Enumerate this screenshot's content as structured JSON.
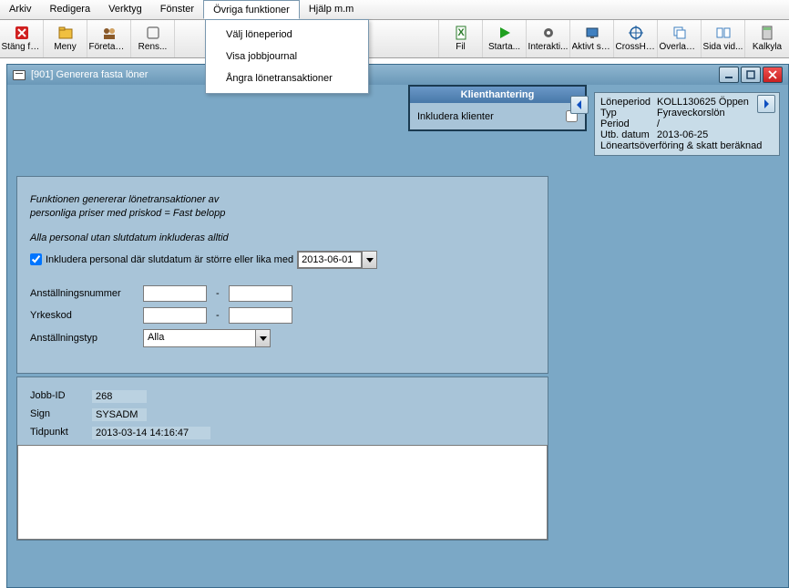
{
  "menubar": {
    "arkiv": "Arkiv",
    "redigera": "Redigera",
    "verktyg": "Verktyg",
    "fonster": "Fönster",
    "ovriga": "Övriga funktioner",
    "hjalp": "Hjälp m.m"
  },
  "dropdown": {
    "valj": "Välj löneperiod",
    "visa": "Visa jobbjournal",
    "angra": "Ångra lönetransaktioner"
  },
  "toolbar": {
    "stang": "Stäng fö...",
    "meny": "Meny",
    "foretag": "Företag/...",
    "rens": "Rens...",
    "fil": "Fil",
    "starta": "Starta...",
    "interakt": "Interakti...",
    "aktivt": "Aktivt skr...",
    "crosshair": "CrossHair",
    "overlapp": "Överlapp...",
    "sida": "Sida vid...",
    "kalkyla": "Kalkyla"
  },
  "window": {
    "title": "[901]  Generera fasta löner"
  },
  "klient": {
    "header": "Klienthantering",
    "inkludera": "Inkludera klienter"
  },
  "info": {
    "loneperiod_k": "Löneperiod",
    "loneperiod_v": "KOLL130625 Öppen",
    "typ_k": "Typ",
    "typ_v": "Fyraveckorslön",
    "period_k": "Period",
    "period_v": "/",
    "utb_k": "Utb. datum",
    "utb_v": "2013-06-25",
    "status": "Löneartsöverföring & skatt beräknad"
  },
  "panel1": {
    "desc1": "Funktionen genererar lönetransaktioner av",
    "desc2": "personliga priser med priskod = Fast belopp",
    "alltid": "Alla personal utan slutdatum inkluderas alltid",
    "inkludera_label": "Inkludera personal där slutdatum är större eller lika med",
    "date": "2013-06-01",
    "anstallningsnummer": "Anställningsnummer",
    "yrkeskod": "Yrkeskod",
    "anstallningstyp": "Anställningstyp",
    "alla": "Alla"
  },
  "panel2": {
    "jobbid_k": "Jobb-ID",
    "jobbid_v": "268",
    "sign_k": "Sign",
    "sign_v": "SYSADM",
    "tidpunkt_k": "Tidpunkt",
    "tidpunkt_v": "2013-03-14 14:16:47"
  }
}
